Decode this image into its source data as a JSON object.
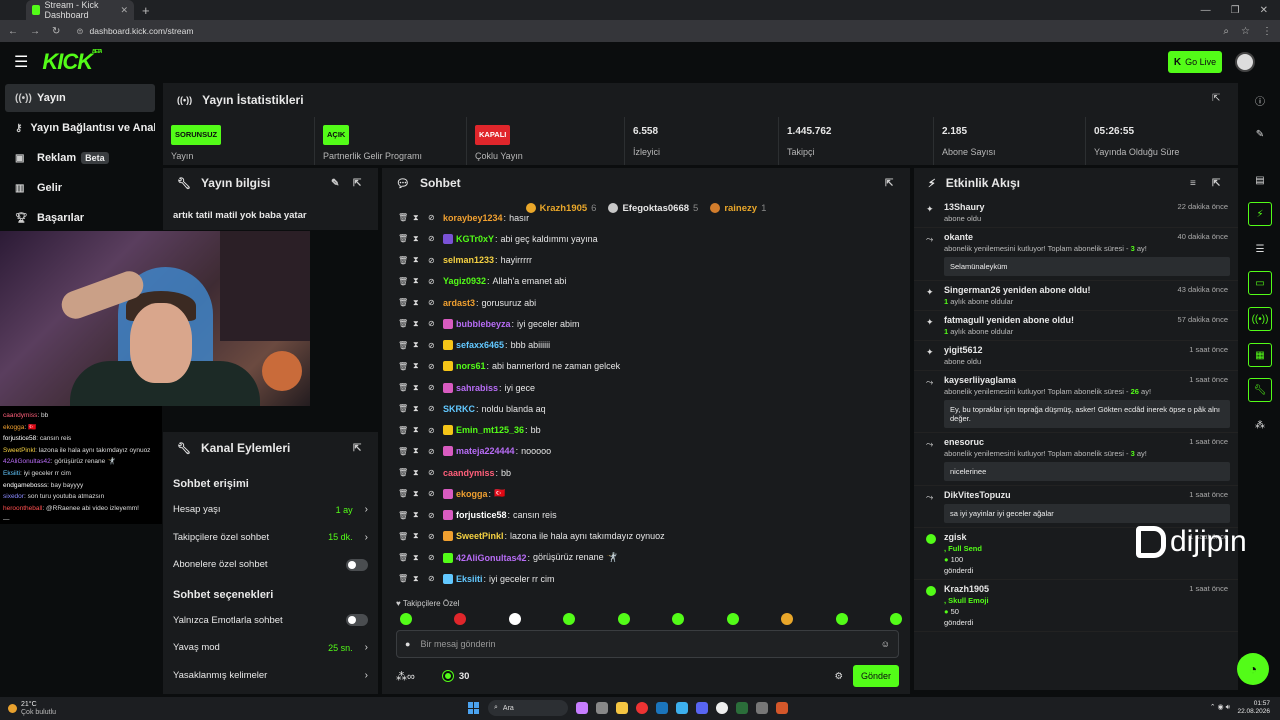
{
  "browser": {
    "tab_title": "Stream - Kick Dashboard",
    "tab_close": "✕",
    "new_tab": "+",
    "window_controls": [
      "—",
      "❐",
      "✕"
    ],
    "url": "dashboard.kick.com/stream"
  },
  "topbar": {
    "logo": "KICK",
    "logo_sup": "BETA",
    "go_live_label": "Go Live",
    "go_live_k": "K"
  },
  "sidebar": {
    "items": [
      {
        "label": "Yayın",
        "icon": "broadcast-icon"
      },
      {
        "label": "Yayın Bağlantısı ve Anahtarı",
        "icon": "key-icon"
      },
      {
        "label": "Reklam",
        "icon": "ad-icon",
        "badge": "Beta"
      },
      {
        "label": "Gelir",
        "icon": "revenue-icon"
      },
      {
        "label": "Başarılar",
        "icon": "trophy-icon"
      }
    ]
  },
  "overlay_chat": [
    {
      "user": "caandymiss",
      "text": "bb",
      "color": "#ff5f7a"
    },
    {
      "user": "ekogga",
      "text": "🇹🇷",
      "color": "#f0a030"
    },
    {
      "user": "forjustice58",
      "text": "cansın reis",
      "color": "#ffffff"
    },
    {
      "user": "SweetPinkl",
      "text": "lazona ile hala aynı takımdayız oynuoz",
      "color": "#f5d142"
    },
    {
      "user": "42AliGonultas42",
      "text": "görüşürüz renane 🤺",
      "color": "#b76cf5"
    },
    {
      "user": "Eksiiti",
      "text": "iyi geceler rr cim",
      "color": "#62c8ff"
    },
    {
      "user": "endgamebosss",
      "text": "bay bayyyy",
      "color": "#ffffff"
    },
    {
      "user": "sixedor",
      "text": "son turu youtuba atmazsın",
      "color": "#8a8aff"
    },
    {
      "user": "heroontheball",
      "text": "@RRaenee abi video izleyemm!",
      "color": "#ff4f4f"
    },
    {
      "user": "",
      "text": "—",
      "color": "#555555"
    }
  ],
  "stats": {
    "title": "Yayın İstatistikleri",
    "items": [
      {
        "badge": "SORUNSUZ",
        "badge_color": "#53fc18",
        "label": "Yayın"
      },
      {
        "badge": "AÇIK",
        "badge_color": "#53fc18",
        "label": "Partnerlik Gelir Programı"
      },
      {
        "badge": "KAPALI",
        "badge_color": "#e0262b",
        "label": "Çoklu Yayın"
      },
      {
        "value": "6.558",
        "label": "İzleyici"
      },
      {
        "value": "1.445.762",
        "label": "Takipçi"
      },
      {
        "value": "2.185",
        "label": "Abone Sayısı"
      },
      {
        "value": "05:26:55",
        "label": "Yayında Olduğu Süre"
      }
    ]
  },
  "stream_info": {
    "title": "Yayın bilgisi",
    "text": "artık tatil matil yok baba yatar"
  },
  "channel_actions": {
    "title": "Kanal Eylemleri",
    "chat_access_title": "Sohbet erişimi",
    "rows1": [
      {
        "label": "Hesap yaşı",
        "value": "1 ay",
        "type": "value"
      },
      {
        "label": "Takipçilere özel sohbet",
        "value": "15 dk.",
        "type": "value"
      },
      {
        "label": "Abonelere özel sohbet",
        "value": "",
        "type": "toggle"
      }
    ],
    "chat_options_title": "Sohbet seçenekleri",
    "rows2": [
      {
        "label": "Yalnızca Emotlarla sohbet",
        "value": "",
        "type": "toggle"
      },
      {
        "label": "Yavaş mod",
        "value": "25 sn.",
        "type": "value"
      },
      {
        "label": "Yasaklanmış kelimeler",
        "value": "",
        "type": "link"
      }
    ]
  },
  "chat": {
    "title": "Sohbet",
    "pinned": [
      {
        "name": "Krazh1905",
        "count": "6",
        "color": "#e9a72a"
      },
      {
        "name": "Efegoktas0668",
        "count": "5",
        "color": "#c8c8c8"
      },
      {
        "name": "rainezy",
        "count": "1",
        "color": "#d27d2c"
      }
    ],
    "messages": [
      {
        "user": "koraybey1234",
        "text": "hasır",
        "color": "#f0a030",
        "badge": ""
      },
      {
        "user": "KGTr0xY",
        "text": "abi geç kaldımmı yayına",
        "color": "#53fc18",
        "badge": "#7a52d6"
      },
      {
        "user": "selman1233",
        "text": "hayirrrrr",
        "color": "#f5d142",
        "badge": ""
      },
      {
        "user": "Yagiz0932",
        "text": "Allah'a emanet abi",
        "color": "#53fc18",
        "badge": ""
      },
      {
        "user": "ardast3",
        "text": "gorusuruz abi",
        "color": "#f0a030",
        "badge": ""
      },
      {
        "user": "bubblebeyza",
        "text": "iyi geceler abim",
        "color": "#b76cf5",
        "badge": "#d85bc0"
      },
      {
        "user": "sefaxx6465",
        "text": "bbb abiiiiii",
        "color": "#62c8ff",
        "badge": "#f5c518"
      },
      {
        "user": "nors61",
        "text": "abi bannerlord ne zaman gelcek",
        "color": "#53fc18",
        "badge": "#f5c518"
      },
      {
        "user": "sahrabiss",
        "text": "iyi gece",
        "color": "#b76cf5",
        "badge": "#d85bc0"
      },
      {
        "user": "SKRKC",
        "text": "noldu blanda aq",
        "color": "#62c8ff",
        "badge": ""
      },
      {
        "user": "Emin_mt125_36",
        "text": "bb",
        "color": "#53fc18",
        "badge": "#f5c518"
      },
      {
        "user": "mateja224444",
        "text": "nooooo",
        "color": "#b76cf5",
        "badge": "#d85bc0"
      },
      {
        "user": "caandymiss",
        "text": "bb",
        "color": "#ff5f7a",
        "badge": ""
      },
      {
        "user": "ekogga",
        "text": "🇹🇷",
        "color": "#f0a030",
        "badge": "#d85bc0"
      },
      {
        "user": "forjustice58",
        "text": "cansın reis",
        "color": "#ffffff",
        "badge": "#d85bc0"
      },
      {
        "user": "SweetPinkl",
        "text": "lazona ile hala aynı takımdayız oynuoz",
        "color": "#f5d142",
        "badge": "#f0a030"
      },
      {
        "user": "42AliGonultas42",
        "text": "görüşürüz renane 🤺",
        "color": "#b76cf5",
        "badge": "#53fc18"
      },
      {
        "user": "Eksiiti",
        "text": "iyi geceler rr cim",
        "color": "#62c8ff",
        "badge": "#62c8ff"
      }
    ],
    "followers_only_label": "Takipçilere Özel",
    "input_placeholder": "Bir mesaj gönderin",
    "points": "30",
    "send_label": "Gönder"
  },
  "events": {
    "title": "Etkinlik Akışı",
    "items": [
      {
        "type": "sub",
        "name": "13Shaury",
        "time": "22 dakika önce",
        "desc": "abone oldu"
      },
      {
        "type": "resub",
        "name": "okante",
        "time": "40 dakika önce",
        "desc_pre": "abonelik yenilemesini kutluyor! Toplam abonelik süresi - ",
        "desc_val": "3",
        "desc_post": " ay!",
        "message": "Selamünaleyküm"
      },
      {
        "type": "sub",
        "name": "Singerman26 yeniden abone oldu!",
        "time": "43 dakika önce",
        "desc_pre": "",
        "desc_val": "1",
        "desc_post": " aylık abone oldular"
      },
      {
        "type": "sub",
        "name": "fatmagull yeniden abone oldu!",
        "time": "57 dakika önce",
        "desc_pre": "",
        "desc_val": "1",
        "desc_post": " aylık abone oldular"
      },
      {
        "type": "sub",
        "name": "yigit5612",
        "time": "1 saat önce",
        "desc": "abone oldu"
      },
      {
        "type": "resub",
        "name": "kayserliiyaglama",
        "time": "1 saat önce",
        "desc_pre": "abonelik yenilemesini kutluyor! Toplam abonelik süresi - ",
        "desc_val": "26",
        "desc_post": " ay!",
        "message": "Ey, bu topraklar için toprağa düşmüş, asker! Gökten ecdâd inerek öpse o pâk alnı değer."
      },
      {
        "type": "resub",
        "name": "enesoruc",
        "time": "1 saat önce",
        "desc_pre": "abonelik yenilemesini kutluyor! Toplam abonelik süresi - ",
        "desc_val": "3",
        "desc_post": " ay!",
        "message": "nicelerinee"
      },
      {
        "type": "resub",
        "name": "DikVitesTopuzu",
        "time": "1 saat önce",
        "message": "sa iyi yayinlar iyi geceler ağalar"
      },
      {
        "type": "gift",
        "name": "zgisk",
        "time": "1 saat önce",
        "detail": ", Full Send",
        "amount": "100",
        "sent": "gönderdi"
      },
      {
        "type": "gift",
        "name": "Krazh1905",
        "time": "1 saat önce",
        "detail": ", Skull Emoji",
        "amount": "50",
        "sent": "gönderdi"
      }
    ]
  },
  "watermark": "dijipin",
  "taskbar": {
    "temp": "21°C",
    "weather": "Çok bulutlu",
    "search": "Ara",
    "time": "01:57",
    "date": "22.08.2026"
  }
}
